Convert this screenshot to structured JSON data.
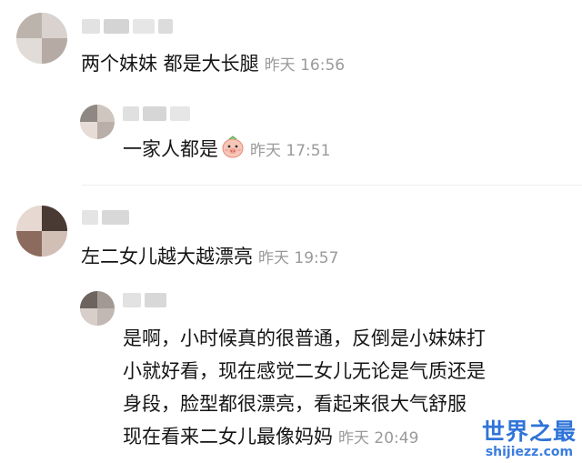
{
  "comments": [
    {
      "text": "两个妹妹 都是大长腿",
      "time": "昨天 16:56",
      "reply": {
        "text": "一家人都是",
        "emoji": "cute-pig-face-icon",
        "time": "昨天 17:51"
      }
    },
    {
      "text": "左二女儿越大越漂亮",
      "time": "昨天 19:57",
      "reply": {
        "lines": [
          "是啊，小时候真的很普通，反倒是小妹妹打",
          "小就好看，现在感觉二女儿无论是气质还是",
          "身段，脸型都很漂亮，看起来很大气舒服",
          "现在看来二女儿最像妈妈"
        ],
        "time": "昨天 20:49"
      }
    }
  ],
  "watermark": {
    "title": "世界之最",
    "url": "shijiezz.com"
  },
  "colors": {
    "text": "#151515",
    "timestamp": "#9a9a9a",
    "watermark": "#2f74d8",
    "divider": "#eeeeee"
  }
}
